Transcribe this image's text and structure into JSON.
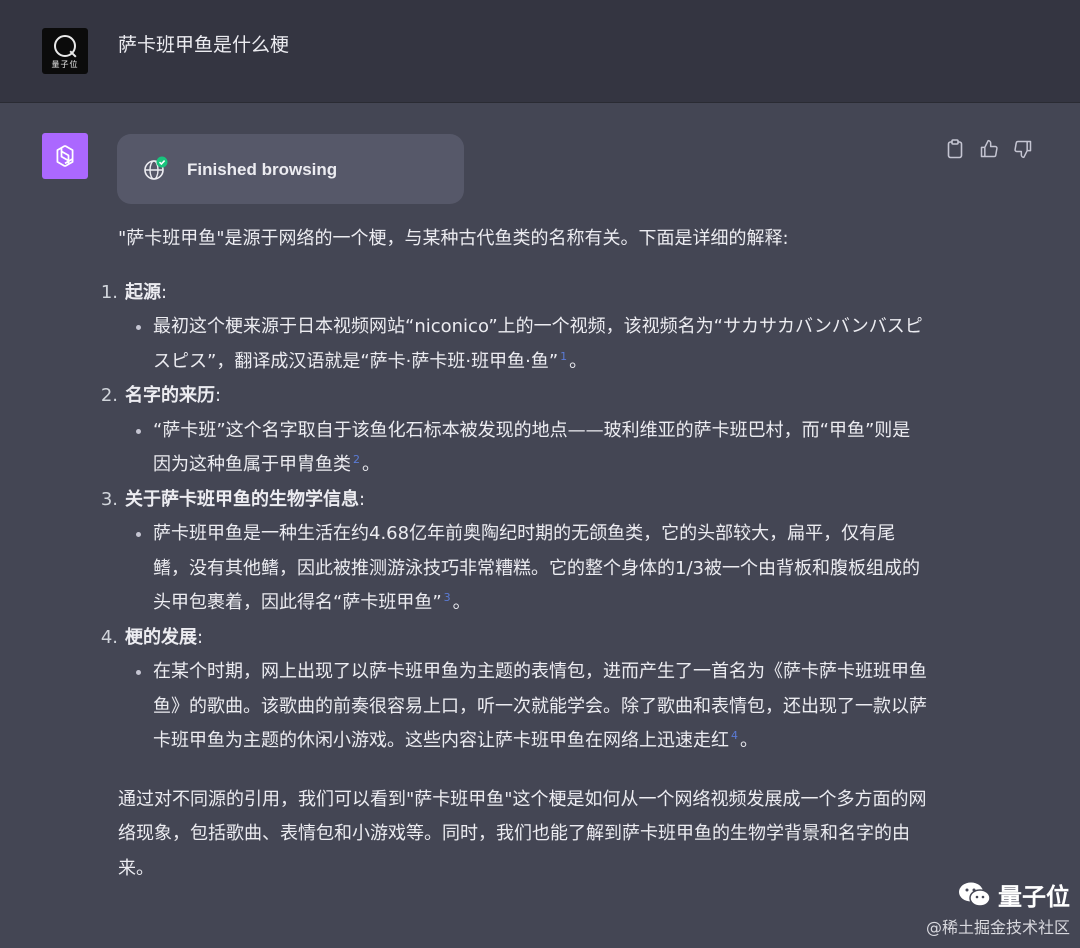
{
  "user": {
    "avatar_text": "量子位",
    "question": "萨卡班甲鱼是什么梗"
  },
  "browsing": {
    "status": "Finished browsing"
  },
  "answer": {
    "intro": "\"萨卡班甲鱼\"是源于网络的一个梗，与某种古代鱼类的名称有关。下面是详细的解释:",
    "items": [
      {
        "number": "1.",
        "heading": "起源",
        "sep": ":",
        "text": "最初这个梗来源于日本视频网站“niconico”上的一个视频，该视频名为“サカサカバンバンバスピスピス”，翻译成汉语就是“萨卡·萨卡班·班甲鱼·鱼”",
        "cite": "1",
        "tail": "。"
      },
      {
        "number": "2.",
        "heading": "名字的来历",
        "sep": ":",
        "text": "“萨卡班”这个名字取自于该鱼化石标本被发现的地点——玻利维亚的萨卡班巴村，而“甲鱼”则是因为这种鱼属于甲胄鱼类",
        "cite": "2",
        "tail": "。"
      },
      {
        "number": "3.",
        "heading": "关于萨卡班甲鱼的生物学信息",
        "sep": ":",
        "text": "萨卡班甲鱼是一种生活在约4.68亿年前奥陶纪时期的无颌鱼类，它的头部较大，扁平，仅有尾鳍，没有其他鳍，因此被推测游泳技巧非常糟糕。它的整个身体的1/3被一个由背板和腹板组成的头甲包裹着，因此得名“萨卡班甲鱼”",
        "cite": "3",
        "tail": "。"
      },
      {
        "number": "4.",
        "heading": "梗的发展",
        "sep": ":",
        "text": "在某个时期，网上出现了以萨卡班甲鱼为主题的表情包，进而产生了一首名为《萨卡萨卡班班甲鱼鱼》的歌曲。该歌曲的前奏很容易上口，听一次就能学会。除了歌曲和表情包，还出现了一款以萨卡班甲鱼为主题的休闲小游戏。这些内容让萨卡班甲鱼在网络上迅速走红",
        "cite": "4",
        "tail": "。"
      }
    ],
    "outro": "通过对不同源的引用，我们可以看到\"萨卡班甲鱼\"这个梗是如何从一个网络视频发展成一个多方面的网络现象，包括歌曲、表情包和小游戏等。同时，我们也能了解到萨卡班甲鱼的生物学背景和名字的由来。"
  },
  "icons": {
    "copy": "clipboard-icon",
    "like": "thumbs-up-icon",
    "dislike": "thumbs-down-icon",
    "browse": "globe-check-icon"
  },
  "watermark": {
    "name": "量子位",
    "site": "@稀土掘金技术社区"
  },
  "colors": {
    "background": "#444654",
    "user_background": "#343541",
    "gpt_avatar": "#ab68ff",
    "pill": "#565869",
    "check_green": "#19c37d"
  }
}
